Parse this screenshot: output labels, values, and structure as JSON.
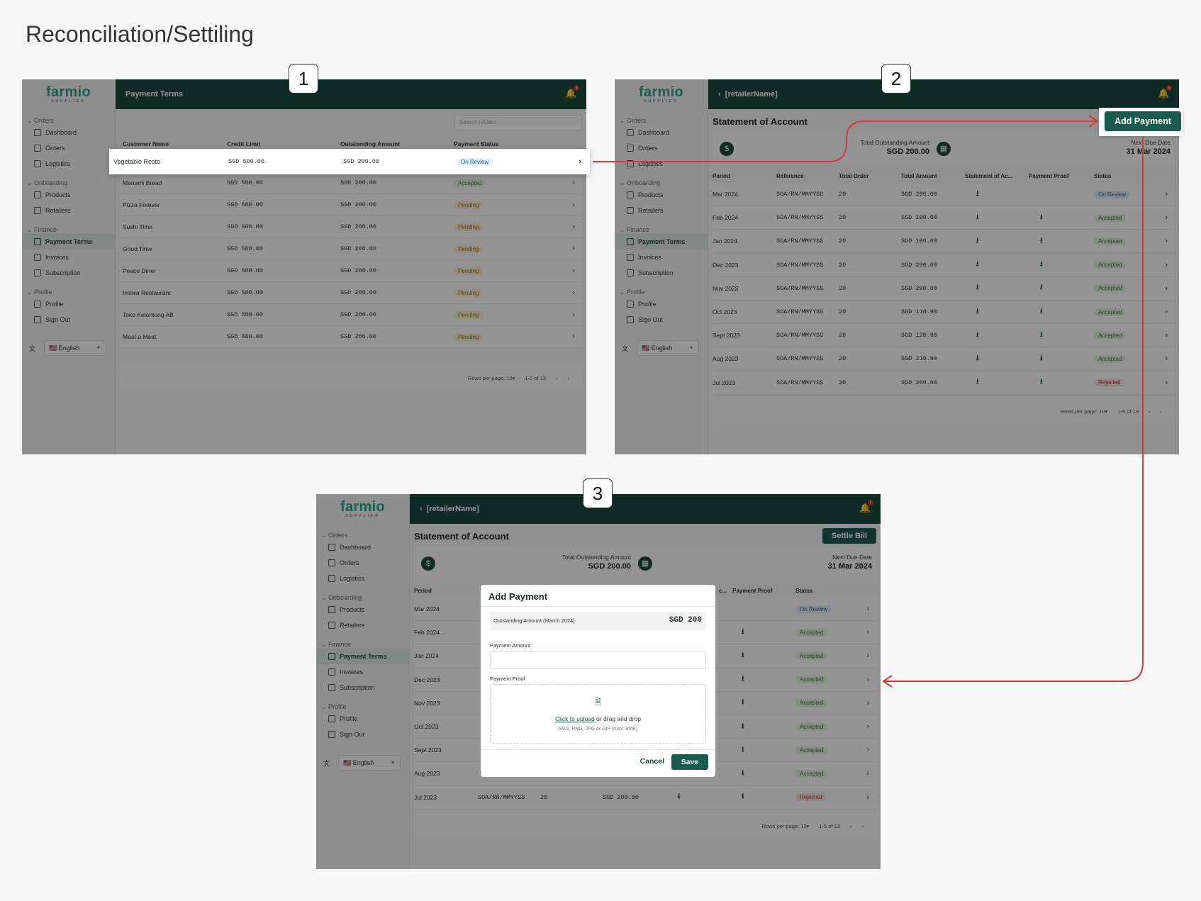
{
  "page_title": "Reconciliation/Settiling",
  "step_numbers": [
    "1",
    "2",
    "3"
  ],
  "brand": {
    "word_a": "farm",
    "word_b": "io",
    "sub": "SUPPLIER"
  },
  "sidebar": {
    "sections": [
      {
        "label": "Orders",
        "items": [
          {
            "label": "Dashboard",
            "icon": "dashboard-icon"
          },
          {
            "label": "Orders",
            "icon": "cart-icon"
          },
          {
            "label": "Logistics",
            "icon": "truck-icon"
          }
        ]
      },
      {
        "label": "Onboarding",
        "items": [
          {
            "label": "Products",
            "icon": "box-icon"
          },
          {
            "label": "Retailers",
            "icon": "users-icon"
          }
        ]
      },
      {
        "label": "Finance",
        "items": [
          {
            "label": "Payment Terms",
            "icon": "cash-icon",
            "active": true
          },
          {
            "label": "Invoices",
            "icon": "invoice-icon"
          },
          {
            "label": "Subscription",
            "icon": "subscription-icon"
          }
        ]
      },
      {
        "label": "Profile",
        "items": [
          {
            "label": "Profile",
            "icon": "user-icon"
          },
          {
            "label": "Sign Out",
            "icon": "signout-icon"
          }
        ]
      }
    ],
    "language": "English",
    "flag": "🇺🇸"
  },
  "screen1": {
    "title": "Payment Terms",
    "notif_count": "1",
    "search_placeholder": "Search retailer",
    "columns": [
      "Customer Name",
      "Credit Limit",
      "Outstanding Amount",
      "Payment Status"
    ],
    "rows": [
      {
        "name": "Vegetable Resto",
        "limit": "SGD 500.00",
        "outstanding": "SGD 200.00",
        "status": "On Review",
        "kind": "review"
      },
      {
        "name": "Manami Bread",
        "limit": "SGD 500.00",
        "outstanding": "SGD 200.00",
        "status": "Accepted",
        "kind": "acc"
      },
      {
        "name": "Pizza Forever",
        "limit": "SGD 500.00",
        "outstanding": "SGD 200.00",
        "status": "Pending",
        "kind": "pen"
      },
      {
        "name": "Sushi Time",
        "limit": "SGD 500.00",
        "outstanding": "SGD 200.00",
        "status": "Pending",
        "kind": "pen"
      },
      {
        "name": "Good Time",
        "limit": "SGD 500.00",
        "outstanding": "SGD 200.00",
        "status": "Pending",
        "kind": "pen"
      },
      {
        "name": "Peace Diner",
        "limit": "SGD 500.00",
        "outstanding": "SGD 200.00",
        "status": "Pending",
        "kind": "pen"
      },
      {
        "name": "Heiwa Restaurant",
        "limit": "SGD 500.00",
        "outstanding": "SGD 200.00",
        "status": "Pending",
        "kind": "pen"
      },
      {
        "name": "Toko Kelontong AB",
        "limit": "SGD 500.00",
        "outstanding": "SGD 200.00",
        "status": "Pending",
        "kind": "pen"
      },
      {
        "name": "Meat a Meat",
        "limit": "SGD 500.00",
        "outstanding": "SGD 200.00",
        "status": "Pending",
        "kind": "pen"
      }
    ],
    "pager": {
      "rows_label": "Rows per page:",
      "rows_value": "10",
      "range": "1-5 of 13"
    }
  },
  "screen2": {
    "title": "[retailerName]",
    "notif_count": "1",
    "heading": "Statement of Account",
    "add_payment": "Add Payment",
    "total_label": "Total Outstanding Amount",
    "total_value": "SGD 200.00",
    "due_label": "Next Due Date",
    "due_value": "31 Mar 2024",
    "columns": [
      "Period",
      "Reference",
      "Total Order",
      "Total Amount",
      "Statement of Ac...",
      "Payment Proof",
      "Status"
    ],
    "rows": [
      {
        "period": "Mar 2024",
        "ref": "SOA/RN/MMYYSS",
        "orders": "20",
        "amount": "SGD 290.00",
        "proof": false,
        "status": "On Review",
        "kind": "review"
      },
      {
        "period": "Feb 2024",
        "ref": "SOA/RN/MMYYSS",
        "orders": "20",
        "amount": "SGD 190.00",
        "proof": true,
        "status": "Accepted",
        "kind": "acc"
      },
      {
        "period": "Jan 2024",
        "ref": "SOA/RN/MMYYSS",
        "orders": "20",
        "amount": "SGD 190.00",
        "proof": true,
        "status": "Accepted",
        "kind": "acc"
      },
      {
        "period": "Dec 2023",
        "ref": "SOA/RN/MMYYSS",
        "orders": "20",
        "amount": "SGD 290.00",
        "proof": true,
        "status": "Accepted",
        "kind": "acc"
      },
      {
        "period": "Nov 2023",
        "ref": "SOA/RN/MMYYSS",
        "orders": "20",
        "amount": "SGD 290.00",
        "proof": true,
        "status": "Accepted",
        "kind": "acc"
      },
      {
        "period": "Oct 2023",
        "ref": "SOA/RN/MMYYSS",
        "orders": "20",
        "amount": "SGD 110.90",
        "proof": true,
        "status": "Accepted",
        "kind": "acc"
      },
      {
        "period": "Sept 2023",
        "ref": "SOA/RN/MMYYSS",
        "orders": "20",
        "amount": "SGD 120.90",
        "proof": true,
        "status": "Accepted",
        "kind": "acc"
      },
      {
        "period": "Aug 2023",
        "ref": "SOA/RN/MMYYSS",
        "orders": "20",
        "amount": "SGD 210.90",
        "proof": true,
        "status": "Accepted",
        "kind": "acc"
      },
      {
        "period": "Jul 2023",
        "ref": "SOA/RN/MMYYSS",
        "orders": "20",
        "amount": "SGD 200.00",
        "proof": true,
        "status": "Rejected",
        "kind": "rej"
      }
    ],
    "pager": {
      "rows_label": "Rows per page:",
      "rows_value": "10",
      "range": "1-5 of 13"
    }
  },
  "screen3": {
    "title": "[retailerName]",
    "notif_count": "1",
    "heading": "Statement of Account",
    "settle": "Settle Bill",
    "total_label": "Total Outstanding Amount",
    "total_value": "SGD 200.00",
    "due_label": "Next Due Date",
    "due_value": "31 Mar 2024",
    "col_period": "Period",
    "col_soa_short": "c...",
    "col_proof": "Payment Proof",
    "col_status": "Status",
    "last_row_ref": "SOA/RN/MMYYSS",
    "last_row_orders": "20",
    "last_row_amount": "SGD 200.00",
    "modal": {
      "title": "Add Payment",
      "outstanding_label": "Outstanding Amount (March 2024)",
      "outstanding_value": "SGD 200",
      "amount_label": "Payment Amount",
      "amount_value": "",
      "proof_label": "Payment Proof",
      "upload_link": "Click to upload",
      "upload_rest": " or drag and drop",
      "upload_hint": "SVG, PNG, JPG or GIF (max. 3MB)",
      "cancel": "Cancel",
      "save": "Save"
    }
  },
  "colors": {
    "primary": "#1a4a3f",
    "accent": "#2aa58c",
    "arrow": "#d03a3a"
  }
}
